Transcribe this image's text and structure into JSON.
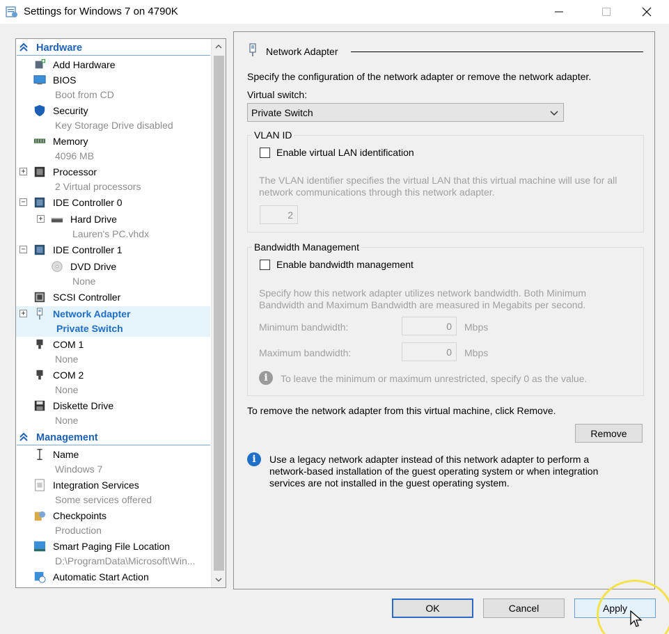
{
  "window": {
    "title": "Settings for Windows 7 on 4790K"
  },
  "tree": {
    "hardware_header": "Hardware",
    "management_header": "Management",
    "hardware_items": [
      {
        "name": "Add Hardware",
        "sub": "",
        "icon": "add-hardware-icon"
      },
      {
        "name": "BIOS",
        "sub": "Boot from CD",
        "icon": "bios-icon"
      },
      {
        "name": "Security",
        "sub": "Key Storage Drive disabled",
        "icon": "shield-icon"
      },
      {
        "name": "Memory",
        "sub": "4096 MB",
        "icon": "memory-icon"
      },
      {
        "name": "Processor",
        "sub": "2 Virtual processors",
        "icon": "processor-icon"
      },
      {
        "name": "IDE Controller 0",
        "sub": "",
        "icon": "ide-controller-icon"
      },
      {
        "name": "Hard Drive",
        "sub": "Lauren's PC.vhdx",
        "icon": "hard-drive-icon"
      },
      {
        "name": "IDE Controller 1",
        "sub": "",
        "icon": "ide-controller-icon"
      },
      {
        "name": "DVD Drive",
        "sub": "None",
        "icon": "dvd-drive-icon"
      },
      {
        "name": "SCSI Controller",
        "sub": "",
        "icon": "scsi-controller-icon"
      },
      {
        "name": "Network Adapter",
        "sub": "Private Switch",
        "icon": "network-adapter-icon"
      },
      {
        "name": "COM 1",
        "sub": "None",
        "icon": "com-port-icon"
      },
      {
        "name": "COM 2",
        "sub": "None",
        "icon": "com-port-icon"
      },
      {
        "name": "Diskette Drive",
        "sub": "None",
        "icon": "diskette-icon"
      }
    ],
    "management_items": [
      {
        "name": "Name",
        "sub": "Windows 7",
        "icon": "name-icon"
      },
      {
        "name": "Integration Services",
        "sub": "Some services offered",
        "icon": "integration-services-icon"
      },
      {
        "name": "Checkpoints",
        "sub": "Production",
        "icon": "checkpoints-icon"
      },
      {
        "name": "Smart Paging File Location",
        "sub": "D:\\ProgramData\\Microsoft\\Win...",
        "icon": "smart-paging-icon"
      },
      {
        "name": "Automatic Start Action",
        "sub": "",
        "icon": "automatic-start-icon"
      }
    ]
  },
  "panel": {
    "title": "Network Adapter",
    "description": "Specify the configuration of the network adapter or remove the network adapter.",
    "virtual_switch_label": "Virtual switch:",
    "virtual_switch_value": "Private Switch",
    "vlan": {
      "group_title": "VLAN ID",
      "checkbox_label": "Enable virtual LAN identification",
      "checked": false,
      "help_line1": "The VLAN identifier specifies the virtual LAN that this virtual machine will use for all",
      "help_line2": "network communications through this network adapter.",
      "value": "2"
    },
    "bandwidth": {
      "group_title": "Bandwidth Management",
      "checkbox_label": "Enable bandwidth management",
      "checked": false,
      "help_line1": "Specify how this network adapter utilizes network bandwidth. Both Minimum",
      "help_line2": "Bandwidth and Maximum Bandwidth are measured in Megabits per second.",
      "min_label": "Minimum bandwidth:",
      "min_value": "0",
      "max_label": "Maximum bandwidth:",
      "max_value": "0",
      "unit": "Mbps",
      "note": "To leave the minimum or maximum unrestricted, specify 0 as the value."
    },
    "remove_text": "To remove the network adapter from this virtual machine, click Remove.",
    "remove_button": "Remove",
    "legacy_line1": "Use a legacy network adapter instead of this network adapter to perform a",
    "legacy_line2": "network-based installation of the guest operating system or when integration",
    "legacy_line3": "services are not installed in the guest operating system."
  },
  "footer": {
    "ok": "OK",
    "cancel": "Cancel",
    "apply": "Apply"
  },
  "colors": {
    "accent": "#1e6fc7",
    "selected_bg": "#e5f3fb",
    "highlight_ring": "#f3e24a"
  }
}
